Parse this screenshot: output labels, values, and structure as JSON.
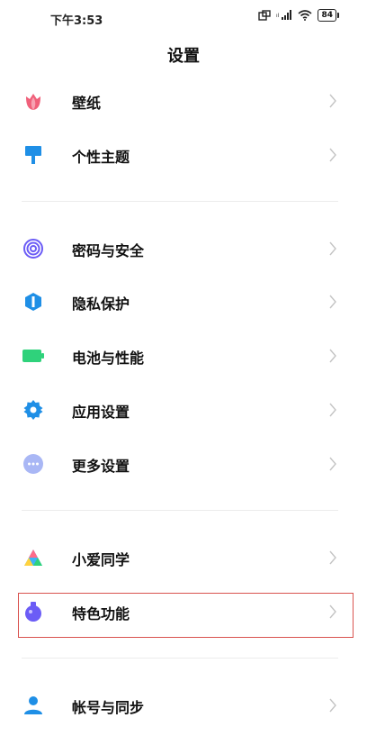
{
  "status_bar": {
    "time": "下午3:53",
    "battery": "84"
  },
  "title": "设置",
  "groups": [
    {
      "items": [
        {
          "label": "壁纸",
          "icon": "tulip-icon"
        },
        {
          "label": "个性主题",
          "icon": "paint-brush-icon"
        }
      ]
    },
    {
      "items": [
        {
          "label": "密码与安全",
          "icon": "fingerprint-icon"
        },
        {
          "label": "隐私保护",
          "icon": "privacy-shield-icon"
        },
        {
          "label": "电池与性能",
          "icon": "battery-icon"
        },
        {
          "label": "应用设置",
          "icon": "gear-icon"
        },
        {
          "label": "更多设置",
          "icon": "more-dots-icon"
        }
      ]
    },
    {
      "items": [
        {
          "label": "小爱同学",
          "icon": "xiaoai-icon"
        },
        {
          "label": "特色功能",
          "icon": "flask-icon"
        }
      ]
    },
    {
      "items": [
        {
          "label": "帐号与同步",
          "icon": "user-icon"
        }
      ]
    }
  ],
  "colors": {
    "highlight": "#d9534f",
    "pink": "#f0607a",
    "blue": "#1f8fe6",
    "green": "#2fd27b",
    "purple": "#6b5cf6"
  }
}
